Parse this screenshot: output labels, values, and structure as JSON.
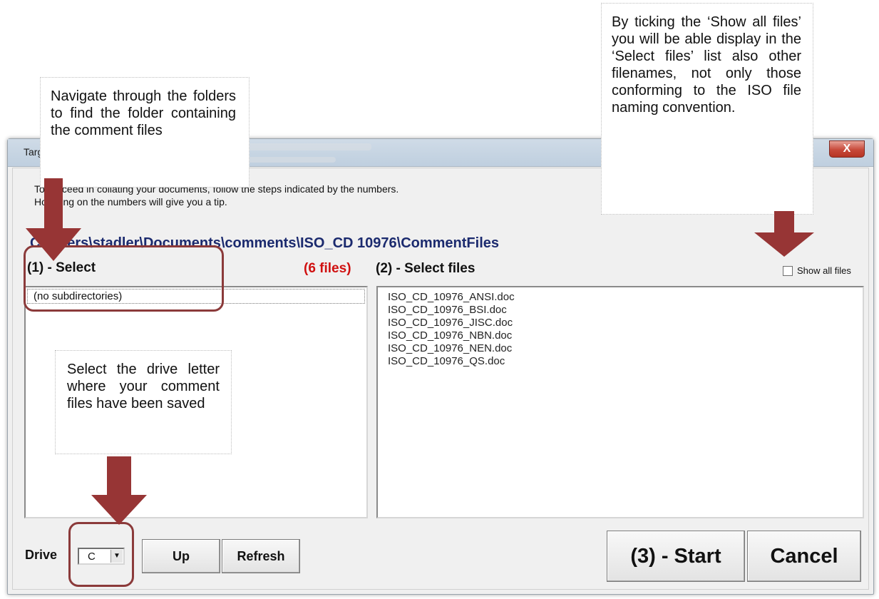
{
  "window": {
    "title_partial": "Targ",
    "close_label": "X"
  },
  "instructions": [
    "To proceed in collating your documents, follow the steps indicated by the numbers.",
    "Hovering on the numbers will give you a tip."
  ],
  "path": "C:\\Users\\stadler\\Documents\\comments\\ISO_CD 10976\\CommentFiles",
  "step1": {
    "label": "(1) - Select"
  },
  "files_count": "(6 files)",
  "step2": {
    "label": "(2) - Select files"
  },
  "show_all": {
    "label": "Show all files",
    "checked": false
  },
  "directories": [
    "(no subdirectories)"
  ],
  "files": [
    "ISO_CD_10976_ANSI.doc",
    "ISO_CD_10976_BSI.doc",
    "ISO_CD_10976_JISC.doc",
    "ISO_CD_10976_NBN.doc",
    "ISO_CD_10976_NEN.doc",
    "ISO_CD_10976_QS.doc"
  ],
  "drive": {
    "label": "Drive",
    "value": "C"
  },
  "buttons": {
    "up": "Up",
    "refresh": "Refresh",
    "start": "(3) - Start",
    "cancel": "Cancel"
  },
  "callouts": {
    "navigate": "Navigate through the folders to find the folder containing the comment files",
    "show_all": "By ticking the ‘Show all files’ you will be able display in the ‘Select files’ list also other filenames, not only those conforming to the ISO file naming convention.",
    "drive": "Select the drive letter where your comment files have been saved"
  },
  "colors": {
    "arrow": "#973535",
    "highlight": "#8b3a3a",
    "count_red": "#d01010",
    "path_blue": "#1b2a6e"
  }
}
